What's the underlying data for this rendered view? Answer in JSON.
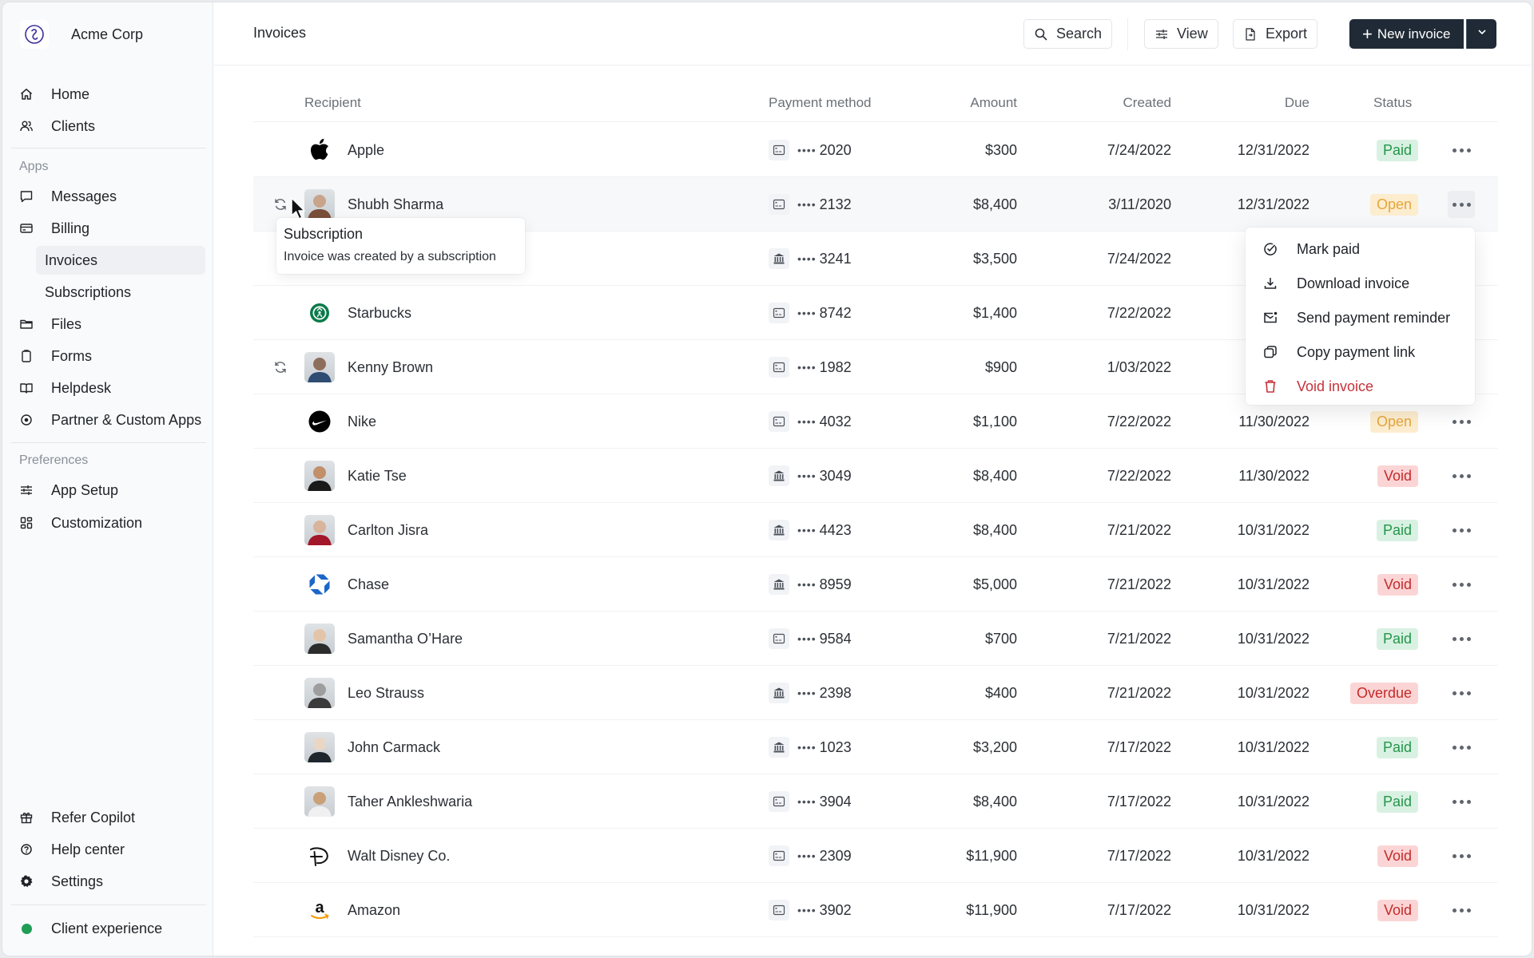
{
  "sidebar": {
    "brand": {
      "name": "Acme Corp",
      "logo_icon": "copilot-logo-icon"
    },
    "items": [
      {
        "id": "home",
        "label": "Home",
        "icon": "home-icon"
      },
      {
        "id": "clients",
        "label": "Clients",
        "icon": "users-icon"
      }
    ],
    "apps_label": "Apps",
    "apps": [
      {
        "id": "messages",
        "label": "Messages",
        "icon": "message-icon"
      },
      {
        "id": "billing",
        "label": "Billing",
        "icon": "credit-card-icon"
      },
      {
        "id": "invoices",
        "label": "Invoices",
        "sub": true,
        "active": true
      },
      {
        "id": "subscriptions",
        "label": "Subscriptions",
        "sub": true
      },
      {
        "id": "files",
        "label": "Files",
        "icon": "folder-icon"
      },
      {
        "id": "forms",
        "label": "Forms",
        "icon": "clipboard-icon"
      },
      {
        "id": "helpdesk",
        "label": "Helpdesk",
        "icon": "book-icon"
      },
      {
        "id": "partner-apps",
        "label": "Partner & Custom Apps",
        "icon": "apps-icon"
      }
    ],
    "preferences_label": "Preferences",
    "preferences": [
      {
        "id": "app-setup",
        "label": "App Setup",
        "icon": "sliders-icon"
      },
      {
        "id": "customization",
        "label": "Customization",
        "icon": "grid-icon"
      }
    ],
    "footer": [
      {
        "id": "refer",
        "label": "Refer Copilot",
        "icon": "gift-icon"
      },
      {
        "id": "help",
        "label": "Help center",
        "icon": "help-circle-icon"
      },
      {
        "id": "settings",
        "label": "Settings",
        "icon": "gear-icon"
      }
    ],
    "client_experience": {
      "label": "Client experience",
      "status_color": "#1f9d55"
    }
  },
  "header": {
    "title": "Invoices",
    "search_label": "Search",
    "view_label": "View",
    "export_label": "Export",
    "new_invoice_label": "New invoice"
  },
  "table": {
    "columns": [
      "Recipient",
      "Payment method",
      "Amount",
      "Created",
      "Due",
      "Status"
    ],
    "rows": [
      {
        "recipient": "Apple",
        "logo": "apple-logo",
        "subscription": false,
        "pm_type": "card",
        "pm_last4": "2020",
        "amount": "$300",
        "created": "7/24/2022",
        "due": "12/31/2022",
        "status": "Paid"
      },
      {
        "recipient": "Shubh Sharma",
        "logo": "avatar",
        "subscription": true,
        "pm_type": "card",
        "pm_last4": "2132",
        "amount": "$8,400",
        "created": "3/11/2020",
        "due": "12/31/2022",
        "status": "Open"
      },
      {
        "recipient": "",
        "logo": "hidden",
        "subscription": false,
        "pm_type": "bank",
        "pm_last4": "3241",
        "amount": "$3,500",
        "created": "7/24/2022",
        "due": "12/",
        "status": ""
      },
      {
        "recipient": "Starbucks",
        "logo": "starbucks-logo",
        "subscription": false,
        "pm_type": "card",
        "pm_last4": "8742",
        "amount": "$1,400",
        "created": "7/22/2022",
        "due": "11/",
        "status": ""
      },
      {
        "recipient": "Kenny Brown",
        "logo": "avatar",
        "subscription": true,
        "pm_type": "card",
        "pm_last4": "1982",
        "amount": "$900",
        "created": "1/03/2022",
        "due": "11/",
        "status": ""
      },
      {
        "recipient": "Nike",
        "logo": "nike-logo",
        "subscription": false,
        "pm_type": "card",
        "pm_last4": "4032",
        "amount": "$1,100",
        "created": "7/22/2022",
        "due": "11/30/2022",
        "status": "Open"
      },
      {
        "recipient": "Katie Tse",
        "logo": "avatar",
        "subscription": false,
        "pm_type": "bank",
        "pm_last4": "3049",
        "amount": "$8,400",
        "created": "7/22/2022",
        "due": "11/30/2022",
        "status": "Void"
      },
      {
        "recipient": "Carlton Jisra",
        "logo": "avatar",
        "subscription": false,
        "pm_type": "bank",
        "pm_last4": "4423",
        "amount": "$8,400",
        "created": "7/21/2022",
        "due": "10/31/2022",
        "status": "Paid"
      },
      {
        "recipient": "Chase",
        "logo": "chase-logo",
        "subscription": false,
        "pm_type": "bank",
        "pm_last4": "8959",
        "amount": "$5,000",
        "created": "7/21/2022",
        "due": "10/31/2022",
        "status": "Void"
      },
      {
        "recipient": "Samantha O’Hare",
        "logo": "avatar",
        "subscription": false,
        "pm_type": "card",
        "pm_last4": "9584",
        "amount": "$700",
        "created": "7/21/2022",
        "due": "10/31/2022",
        "status": "Paid"
      },
      {
        "recipient": "Leo Strauss",
        "logo": "avatar",
        "subscription": false,
        "pm_type": "bank",
        "pm_last4": "2398",
        "amount": "$400",
        "created": "7/21/2022",
        "due": "10/31/2022",
        "status": "Overdue"
      },
      {
        "recipient": "John Carmack",
        "logo": "avatar",
        "subscription": false,
        "pm_type": "bank",
        "pm_last4": "1023",
        "amount": "$3,200",
        "created": "7/17/2022",
        "due": "10/31/2022",
        "status": "Paid"
      },
      {
        "recipient": "Taher Ankleshwaria",
        "logo": "avatar",
        "subscription": false,
        "pm_type": "card",
        "pm_last4": "3904",
        "amount": "$8,400",
        "created": "7/17/2022",
        "due": "10/31/2022",
        "status": "Paid"
      },
      {
        "recipient": "Walt Disney Co.",
        "logo": "disney-logo",
        "subscription": false,
        "pm_type": "card",
        "pm_last4": "2309",
        "amount": "$11,900",
        "created": "7/17/2022",
        "due": "10/31/2022",
        "status": "Void"
      },
      {
        "recipient": "Amazon",
        "logo": "amazon-logo",
        "subscription": false,
        "pm_type": "card",
        "pm_last4": "3902",
        "amount": "$11,900",
        "created": "7/17/2022",
        "due": "10/31/2022",
        "status": "Void"
      }
    ],
    "masked_prefix": "••••"
  },
  "tooltip": {
    "title": "Subscription",
    "body": "Invoice was created by a subscription"
  },
  "row_menu": {
    "items": [
      {
        "label": "Mark paid",
        "icon": "check-circle-icon"
      },
      {
        "label": "Download invoice",
        "icon": "download-icon"
      },
      {
        "label": "Send payment reminder",
        "icon": "mail-notification-icon"
      },
      {
        "label": "Copy payment link",
        "icon": "copy-icon"
      },
      {
        "label": "Void invoice",
        "icon": "trash-icon",
        "danger": true
      }
    ]
  },
  "colors": {
    "primary_button": "#1f2a36",
    "paid": "#24964a",
    "open": "#e6a63b",
    "void": "#c42b2b",
    "danger": "#c6323a"
  }
}
